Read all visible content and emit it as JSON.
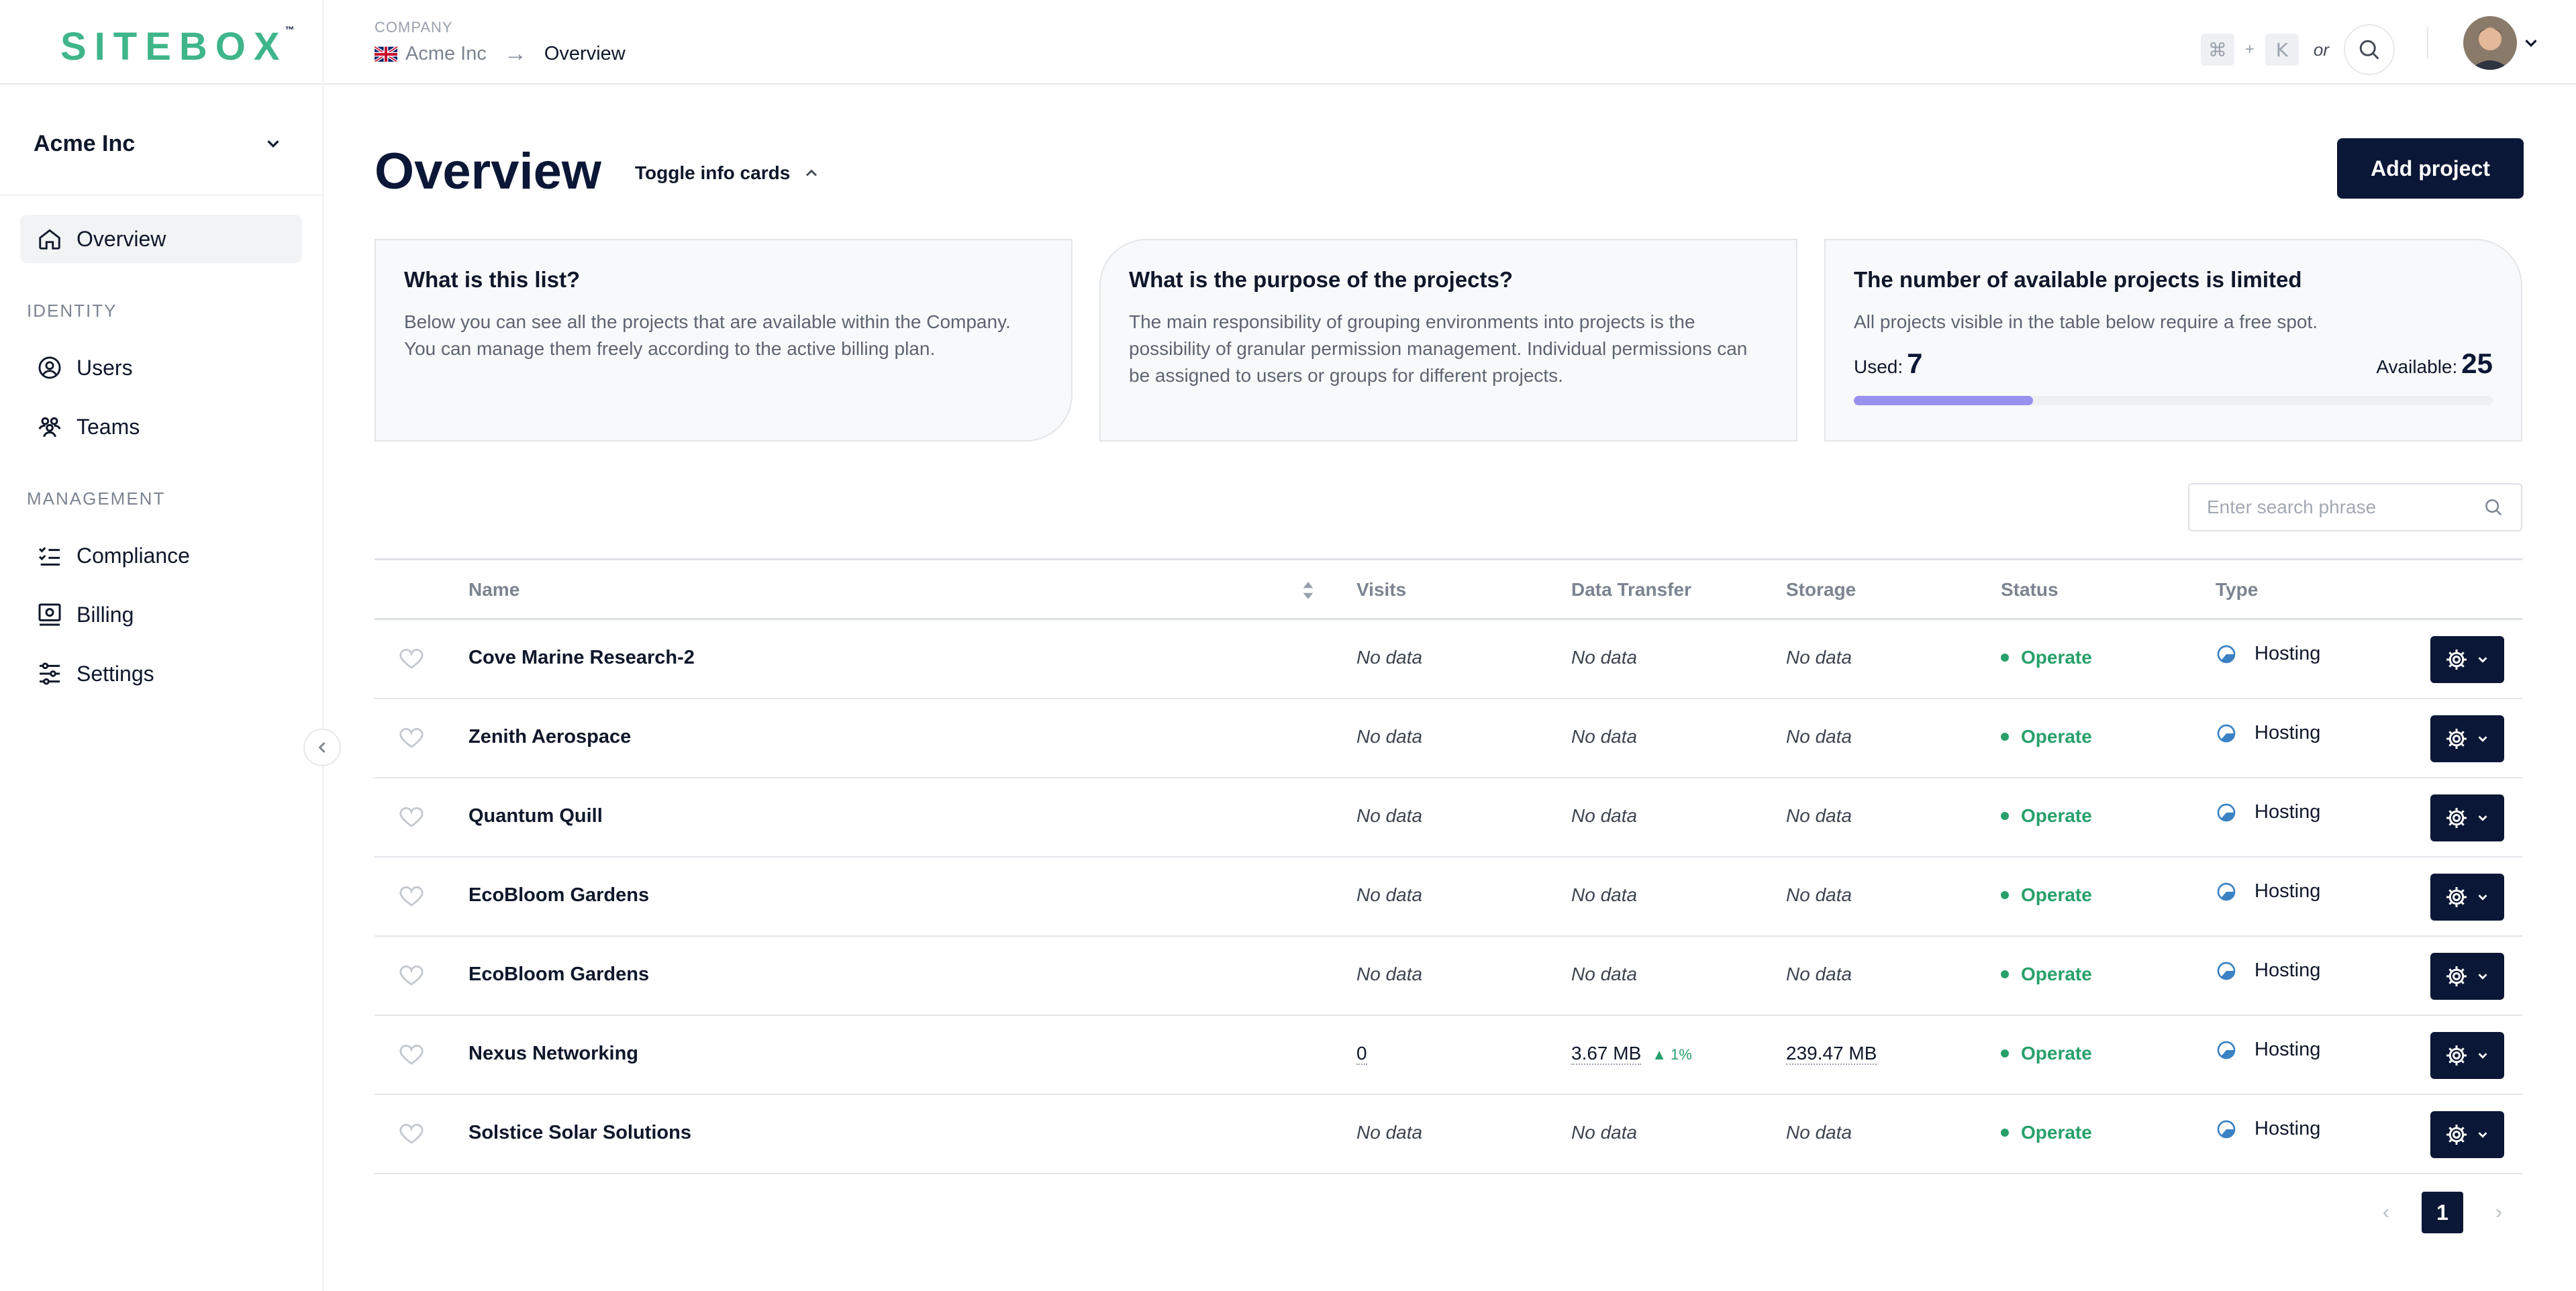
{
  "header": {
    "logo_main": "SITEBOX",
    "logo_tm": "™",
    "breadcrumb_label": "COMPANY",
    "breadcrumb_company": "Acme Inc",
    "breadcrumb_arrow": "→",
    "breadcrumb_current": "Overview",
    "shortcut_key1": "⌘",
    "shortcut_plus": "+",
    "shortcut_key2": "K",
    "shortcut_or": "or"
  },
  "sidebar": {
    "org_name": "Acme Inc",
    "items": [
      {
        "label": "Overview",
        "icon": "home-icon",
        "active": true
      },
      {
        "label": "Users",
        "icon": "user-circle-icon"
      },
      {
        "label": "Teams",
        "icon": "team-icon"
      },
      {
        "label": "Compliance",
        "icon": "checklist-icon"
      },
      {
        "label": "Billing",
        "icon": "billing-icon"
      },
      {
        "label": "Settings",
        "icon": "sliders-icon"
      }
    ],
    "sections": {
      "identity": "IDENTITY",
      "management": "MANAGEMENT"
    }
  },
  "main": {
    "title": "Overview",
    "toggle_label": "Toggle info cards",
    "add_button": "Add project",
    "cards": [
      {
        "title": "What is this list?",
        "text": "Below you can see all the projects that are available within the Company. You can manage them freely according to the active billing plan."
      },
      {
        "title": "What is the purpose of the projects?",
        "text": "The main responsibility of grouping environments into projects is the possibility of granular permission management. Individual permissions can be assigned to users or groups for different projects."
      },
      {
        "title": "The number of available projects is limited",
        "text": "All projects visible in the table below require a free spot.",
        "used_label": "Used:",
        "used": "7",
        "available_label": "Available:",
        "available": "25",
        "used_fraction": 0.28
      }
    ],
    "search_placeholder": "Enter search phrase"
  },
  "table": {
    "columns": {
      "name": "Name",
      "visits": "Visits",
      "transfer": "Data Transfer",
      "storage": "Storage",
      "status": "Status",
      "type": "Type"
    },
    "rows": [
      {
        "name": "Cove Marine Research-2",
        "visits": "No data",
        "transfer": "No data",
        "storage": "No data",
        "status": "Operate",
        "type": "Hosting"
      },
      {
        "name": "Zenith Aerospace",
        "visits": "No data",
        "transfer": "No data",
        "storage": "No data",
        "status": "Operate",
        "type": "Hosting"
      },
      {
        "name": "Quantum Quill",
        "visits": "No data",
        "transfer": "No data",
        "storage": "No data",
        "status": "Operate",
        "type": "Hosting"
      },
      {
        "name": "EcoBloom Gardens",
        "visits": "No data",
        "transfer": "No data",
        "storage": "No data",
        "status": "Operate",
        "type": "Hosting"
      },
      {
        "name": "EcoBloom Gardens",
        "visits": "No data",
        "transfer": "No data",
        "storage": "No data",
        "status": "Operate",
        "type": "Hosting"
      },
      {
        "name": "Nexus Networking",
        "visits": "0",
        "transfer": "3.67 MB",
        "transfer_trend": "1%",
        "storage": "239.47 MB",
        "status": "Operate",
        "type": "Hosting"
      },
      {
        "name": "Solstice Solar Solutions",
        "visits": "No data",
        "transfer": "No data",
        "storage": "No data",
        "status": "Operate",
        "type": "Hosting"
      }
    ]
  },
  "pagination": {
    "current": "1",
    "prev": "‹",
    "next": "›"
  },
  "colors": {
    "brand": "#0b1736",
    "accent_green": "#3fb58a",
    "status_green": "#27a06a",
    "progress": "#9a91ee"
  }
}
